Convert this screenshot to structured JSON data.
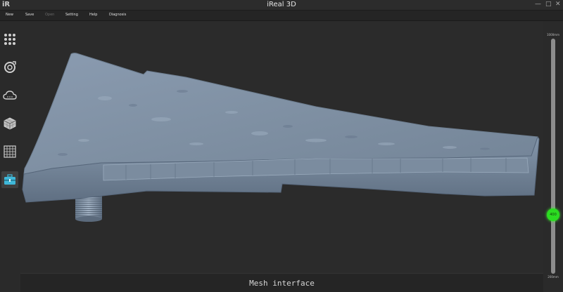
{
  "window": {
    "logo": "iR",
    "title": "iReal 3D",
    "controls": [
      "—",
      "□",
      "✕"
    ]
  },
  "menu": [
    {
      "label": "New",
      "enabled": true
    },
    {
      "label": "Save",
      "enabled": true
    },
    {
      "label": "Open",
      "enabled": false
    },
    {
      "label": "Setting",
      "enabled": true
    },
    {
      "label": "Help",
      "enabled": true
    },
    {
      "label": "Diagnosis",
      "enabled": true
    }
  ],
  "toolbar": [
    {
      "icon": "dots-grid-icon",
      "active": false
    },
    {
      "icon": "target-icon",
      "active": false
    },
    {
      "icon": "cloud-icon",
      "active": false
    },
    {
      "icon": "cube-icon",
      "active": false
    },
    {
      "icon": "grid-icon",
      "active": false
    },
    {
      "icon": "toolbox-icon",
      "active": true
    }
  ],
  "status": {
    "text": "Mesh interface"
  },
  "slider": {
    "max_label": "1000mm",
    "min_label": "200mm",
    "value_label": "400",
    "min": 200,
    "max": 1000,
    "value": 400
  },
  "colors": {
    "mesh": "#7f90a3",
    "accent": "#2bdc21"
  }
}
